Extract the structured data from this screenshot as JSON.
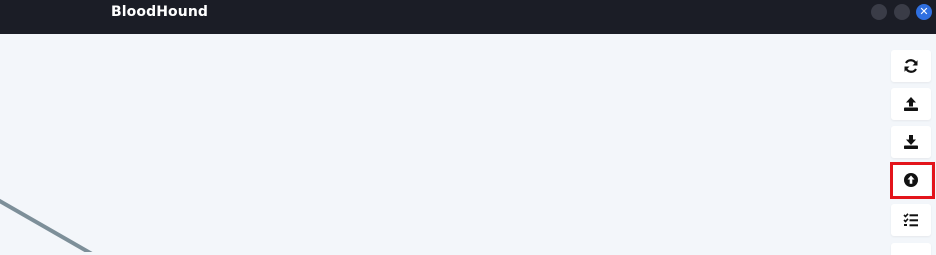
{
  "window": {
    "title": "BloodHound",
    "close_glyph": "✕"
  },
  "toolbar": {
    "buttons": [
      {
        "name": "refresh",
        "icon": "refresh-icon"
      },
      {
        "name": "upload-data",
        "icon": "upload-icon"
      },
      {
        "name": "export-graph",
        "icon": "download-icon"
      },
      {
        "name": "import-graph",
        "icon": "arrow-circle-up-icon"
      },
      {
        "name": "queries",
        "icon": "list-check-icon"
      }
    ],
    "highlighted": "import-graph"
  },
  "colors": {
    "titlebar": "#1b1d26",
    "canvas": "#f3f6fa",
    "highlight": "#e3141b",
    "edge": "#7d8f99",
    "close_button": "#2f6fe0"
  }
}
